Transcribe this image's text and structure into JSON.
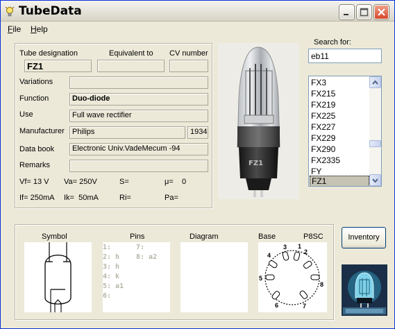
{
  "window": {
    "title": "TubeData"
  },
  "menu": {
    "file": "File",
    "file_key": "F",
    "file_rest": "ile",
    "help": "Help",
    "help_key": "H",
    "help_rest": "elp"
  },
  "fields": {
    "tube_designation_label": "Tube designation",
    "tube_designation": "FZ1",
    "equivalent_label": "Equivalent to",
    "equivalent": "",
    "cv_label": "CV number",
    "cv": "",
    "variations_label": "Variations",
    "variations": "",
    "function_label": "Function",
    "function": "Duo-diode",
    "use_label": "Use",
    "use": "Full wave rectifier",
    "manufacturer_label": "Manufacturer",
    "manufacturer": "Philips",
    "year": "1934",
    "databook_label": "Data book",
    "databook": "Electronic Univ.VadeMecum -94",
    "remarks_label": "Remarks",
    "remarks": ""
  },
  "params": {
    "vf": "Vf= 13 V",
    "va": "Va= 250V",
    "s": "S=",
    "mu": "μ=    0",
    "if": "If= 250mA",
    "ik": "Ik=  50mA",
    "ri": "Ri=",
    "pa": "Pa="
  },
  "search": {
    "label": "Search for:",
    "value": "eb11"
  },
  "tube_list": [
    "FX3",
    "FX215",
    "FX219",
    "FX225",
    "FX227",
    "FX229",
    "FX290",
    "FX2335",
    "FY",
    "FZ1"
  ],
  "tube_list_selected": "FZ1",
  "panels": {
    "symbol_label": "Symbol",
    "pins_label": "Pins",
    "diagram_label": "Diagram",
    "base_label": "Base",
    "base_type": "P8SC"
  },
  "pins": {
    "p1": "1:",
    "p2": "2: h",
    "p3": "3: h",
    "p4": "4: k",
    "p5": "5: a1",
    "p6": "6:",
    "p7": "7:",
    "p8": "8: a2"
  },
  "base_pin_numbers": [
    "1",
    "2",
    "3",
    "4",
    "5",
    "6",
    "7",
    "8"
  ],
  "inventory_button": "Inventory",
  "colors": {
    "background": "#ece9d8",
    "list_selection": "#c6c3b5",
    "pin_text": "#b8b4a8"
  }
}
